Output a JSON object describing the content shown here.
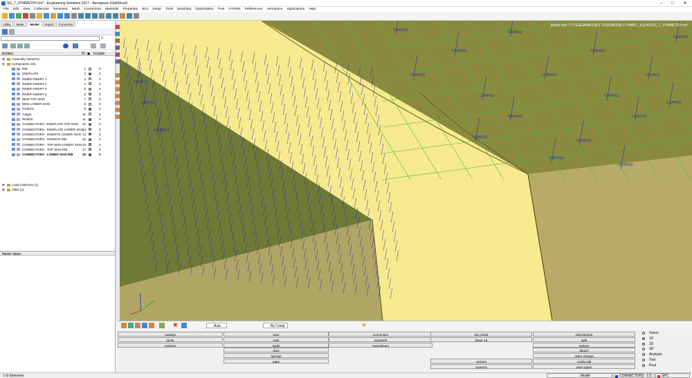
{
  "window": {
    "title": "SG_7_SYMMETRY.hm* - Engineering Solutions 2017 - Aerospace (OptiStruct)",
    "minimize": "–",
    "maximize": "□",
    "close": "✕"
  },
  "menu": [
    "File",
    "Edit",
    "View",
    "Collectors",
    "Geometry",
    "Mesh",
    "Connectors",
    "Materials",
    "Properties",
    "BCs",
    "Setup",
    "Tools",
    "Morphing",
    "Optimization",
    "Post",
    "XYPlots",
    "Preferences",
    "Aerospace",
    "Applications",
    "Help"
  ],
  "panel_tabs": [
    "Utility",
    "Mask",
    "Model",
    "Import",
    "Connector"
  ],
  "browser_headers": {
    "entities": "Entities",
    "id": "ID",
    "color": "◼",
    "include": "Include"
  },
  "tree": {
    "assembly": "Assembly Hierarchy",
    "components": "Components (18)",
    "items": [
      {
        "name": "RIB",
        "id": "1",
        "color": "#e8d76a",
        "inc": "0"
      },
      {
        "name": "ENDPLATE",
        "id": "2",
        "color": "#3a5fc8",
        "inc": "0"
      },
      {
        "name": "INNER INSERT 1",
        "id": "3",
        "color": "#f2ec7a",
        "inc": "0"
      },
      {
        "name": "INNER INSERT 2",
        "id": "4",
        "color": "#c8c8c8",
        "inc": "0"
      },
      {
        "name": "INNER INSERT 3",
        "id": "5",
        "color": "#d8a640",
        "inc": "0"
      },
      {
        "name": "INNER INSERT 4",
        "id": "6",
        "color": "#8cc85a",
        "inc": "0"
      },
      {
        "name": "NEW TOP SKIN",
        "id": "7",
        "color": "#f4e78a",
        "inc": "0"
      },
      {
        "name": "NEW LOWER SKIN",
        "id": "8",
        "color": "#e8dc72",
        "inc": "0"
      },
      {
        "name": "POINTS",
        "id": "9",
        "color": "#c83030",
        "inc": "0"
      },
      {
        "name": "^edgm",
        "id": "10",
        "color": "#f6ef9a",
        "inc": "0"
      },
      {
        "name": "RIGIDS",
        "id": "11",
        "color": "#4e7d45",
        "inc": "0"
      },
      {
        "name": "CONNECTORS - ENDPLATE TOP SKIN",
        "id": "12",
        "color": "#3aa0a0",
        "inc": "0"
      },
      {
        "name": "CONNECTORS - ENDPLATE LOWER SKIN",
        "id": "13",
        "color": "#c8c0a0",
        "inc": "0"
      },
      {
        "name": "CONNECTORS - INSERTS LOWER SKIN",
        "id": "14",
        "color": "#d04040",
        "inc": "0"
      },
      {
        "name": "CONNECTORS - INSERTS RIB",
        "id": "15",
        "color": "#e07a3a",
        "inc": "0"
      },
      {
        "name": "CONNECTORS - TOP SKIN LOWER SKIN",
        "id": "16",
        "color": "#a06ac8",
        "inc": "0"
      },
      {
        "name": "CONNECTORS - TOP SKIN RIB",
        "id": "17",
        "color": "#7ac8d8",
        "inc": "0"
      },
      {
        "name": "CONNECTORS - LOWER SKIN RIB",
        "id": "18",
        "color": "#2a2ad0",
        "inc": "0"
      }
    ],
    "load_collectors": "Load Collectors (1)",
    "titles": "Titles (1)"
  },
  "props_header": {
    "name": "Name",
    "value": "Value"
  },
  "model_info": "Model Info: C:/TESE/ANALISES TESE/MODELO HM/07_JULHO/SG_7_SYMMETRY.hm*",
  "cgap_label": "CGAP(G)",
  "bottom_toolbar": {
    "auto": "Auto",
    "bycomp": "By Comp"
  },
  "panel": {
    "col1": [
      "masses",
      "joints",
      "markers"
    ],
    "col2": [
      "bars",
      "rods",
      "rigids",
      "rbe3",
      "springs",
      "gaps"
    ],
    "col3": [
      "connectors",
      "spotweld",
      "HyperBeam"
    ],
    "col4": [
      "line mesh",
      "linear 1d"
    ],
    "col4b": [
      "vectors",
      "systems"
    ],
    "col5": [
      "edit element",
      "split",
      "replace",
      "detach",
      "order change",
      "config edit",
      "elem types"
    ]
  },
  "radios": [
    {
      "label": "Geom",
      "checked": false
    },
    {
      "label": "1D",
      "checked": true
    },
    {
      "label": "2D",
      "checked": false
    },
    {
      "label": "3D",
      "checked": false
    },
    {
      "label": "Analysis",
      "checked": false
    },
    {
      "label": "Tool",
      "checked": false
    },
    {
      "label": "Post",
      "checked": false
    }
  ],
  "status": {
    "left": "1-D Elements",
    "model": "Model",
    "component": "CONNECTORS - LO",
    "bc": "SPC"
  }
}
